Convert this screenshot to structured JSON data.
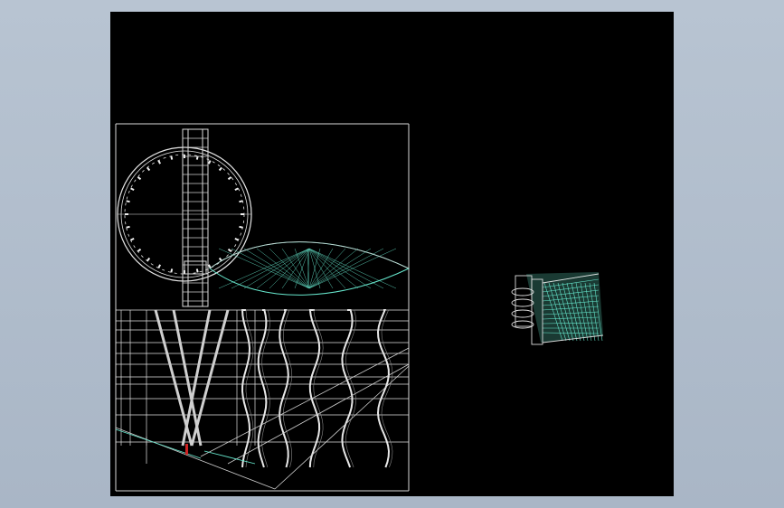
{
  "viewport": {
    "background": "#000000",
    "page_background": "#b0bccb"
  },
  "colors": {
    "line": "#e8e8e8",
    "accent": "#66e6cc",
    "dim": "#9a9a9a",
    "marker": "#cc2222"
  },
  "drawing": {
    "main_view": "banjo-front-and-exploded-views",
    "detail_view": "banjo-neck-detail"
  }
}
